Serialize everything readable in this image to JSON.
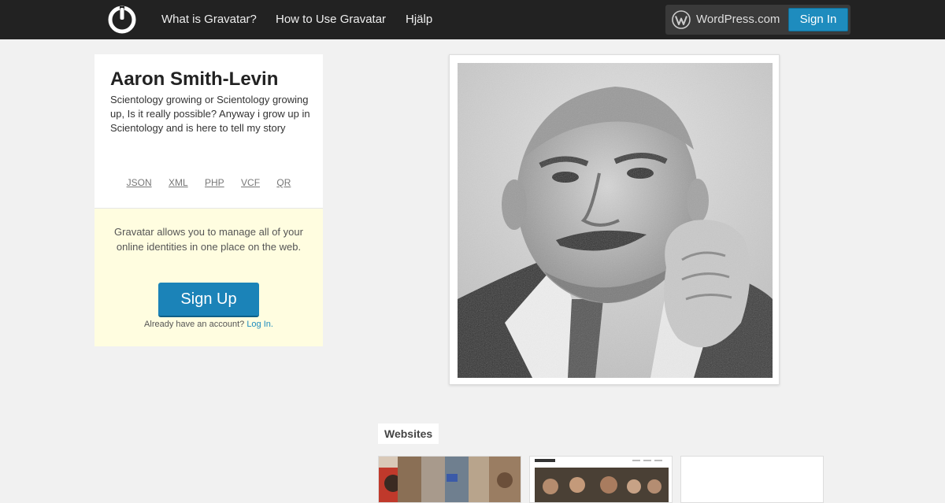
{
  "colors": {
    "topbar_bg": "#222222",
    "page_bg": "#f1f1f1",
    "accent_blue": "#1e8cbe",
    "promo_bg": "#fffde0"
  },
  "topbar": {
    "logo_icon": "gravatar-logo-icon",
    "nav": [
      {
        "label": "What is Gravatar?"
      },
      {
        "label": "How to Use Gravatar"
      },
      {
        "label": "Hjälp"
      }
    ],
    "wordpress_icon": "wordpress-logo-icon",
    "wordpress_label": "WordPress.com",
    "signin_label": "Sign In"
  },
  "profile": {
    "name": "Aaron Smith-Levin",
    "bio": "Scientology growing or Scientology growing up, Is it really possible? Anyway i grow up in Scientology and is here to tell my story",
    "formats": [
      "JSON",
      "XML",
      "PHP",
      "VCF",
      "QR"
    ]
  },
  "promo": {
    "text": "Gravatar allows you to manage all of your online identities in one place on the web.",
    "signup_label": "Sign Up",
    "login_prompt": "Already have an account?",
    "login_link": "Log In."
  },
  "websites": {
    "heading": "Websites"
  }
}
